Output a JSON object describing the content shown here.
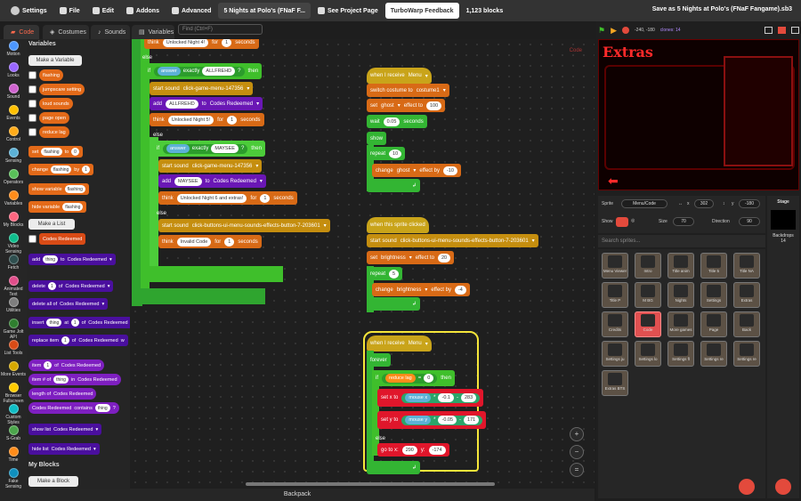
{
  "menubar": {
    "settings": "Settings",
    "file": "File",
    "edit": "Edit",
    "addons": "Addons",
    "advanced": "Advanced",
    "project_title": "5 Nights at Polo's (FNaF F...",
    "see_project": "See Project Page",
    "turbowarp": "TurboWarp Feedback",
    "block_count": "1,123 blocks",
    "save_as": "Save as 5 Nights at Polo's (FNaF Fangame).sb3"
  },
  "tabs": {
    "code": "Code",
    "costumes": "Costumes",
    "sounds": "Sounds",
    "variables": "Variables"
  },
  "find_placeholder": "Find (Ctrl+F)",
  "categories": [
    {
      "label": "Motion",
      "color": "#4c97ff"
    },
    {
      "label": "Looks",
      "color": "#9966ff"
    },
    {
      "label": "Sound",
      "color": "#cf63cf"
    },
    {
      "label": "Events",
      "color": "#ffbf00"
    },
    {
      "label": "Control",
      "color": "#ffab19"
    },
    {
      "label": "Sensing",
      "color": "#5cb1d6"
    },
    {
      "label": "Operators",
      "color": "#59c059"
    },
    {
      "label": "Variables",
      "color": "#ff8c1a"
    },
    {
      "label": "My Blocks",
      "color": "#ff6680"
    },
    {
      "label": "Video Sensing",
      "color": "#0fbd8c"
    },
    {
      "label": "Fetch",
      "color": "#2f4f4f"
    },
    {
      "label": "Animated Text",
      "color": "#e04e8a"
    },
    {
      "label": "Utilities",
      "color": "#7f7f7f"
    },
    {
      "label": "Game Jolt API",
      "color": "#2f7f2f"
    },
    {
      "label": "List Tools",
      "color": "#d94b16"
    },
    {
      "label": "More Events",
      "color": "#d6a800"
    },
    {
      "label": "Browser Fullscreen",
      "color": "#ffcc00"
    },
    {
      "label": "Custom Styles",
      "color": "#0fbdc5"
    },
    {
      "label": "S-Grab",
      "color": "#4ca64c"
    },
    {
      "label": "Time",
      "color": "#ff8c1a"
    },
    {
      "label": "Fake Sensing",
      "color": "#0f8fbd"
    }
  ],
  "palette": {
    "variables_header": "Variables",
    "make_variable": "Make a Variable",
    "vars": [
      "flashing",
      "jumpscare setting",
      "loud sounds",
      "page open",
      "reduce lag"
    ],
    "set_block": {
      "set": "set",
      "var": "flashing",
      "to": "to",
      "val": "0"
    },
    "change_block": {
      "change": "change",
      "var": "flashing",
      "by": "by",
      "val": "1"
    },
    "show_var": {
      "txt": "show variable",
      "var": "flashing"
    },
    "hide_var": {
      "txt": "hide variable",
      "var": "flashing"
    },
    "make_list": "Make a List",
    "list_name": "Codes Redeemed",
    "add_block": {
      "add": "add",
      "thing": "thing",
      "to": "to",
      "list": "Codes Redeemed"
    },
    "delete_block": {
      "del": "delete",
      "n": "1",
      "of": "of",
      "list": "Codes Redeemed"
    },
    "delete_all": {
      "txt": "delete all of",
      "list": "Codes Redeemed"
    },
    "insert_block": {
      "txt": "insert",
      "thing": "thing",
      "at": "at",
      "n": "1",
      "of": "of",
      "list": "Codes Redeemed"
    },
    "replace_block": {
      "txt": "replace item",
      "n": "1",
      "of": "of",
      "list": "Codes Redeemed",
      "w": "w"
    },
    "item_block": {
      "txt": "item",
      "n": "1",
      "of": "of",
      "list": "Codes Redeemed"
    },
    "itemnum_block": {
      "txt": "item # of",
      "thing": "thing",
      "in": "in",
      "list": "Codes Redeemed"
    },
    "length_block": {
      "txt": "length of",
      "list": "Codes Redeemed"
    },
    "contains_block": {
      "list": "Codes Redeemed",
      "txt": "contains",
      "thing": "thing",
      "q": "?"
    },
    "show_list": {
      "txt": "show list",
      "list": "Codes Redeemed"
    },
    "hide_list": {
      "txt": "hide list",
      "list": "Codes Redeemed"
    },
    "myblocks_header": "My Blocks",
    "make_block": "Make a Block"
  },
  "workspace": {
    "code_label": "Code",
    "s1": {
      "think1": {
        "think": "think",
        "msg": "Unlocked Night 4!",
        "for": "for",
        "n": "1",
        "secs": "seconds"
      },
      "else1": "else",
      "if1": {
        "if": "if",
        "answer": "answer",
        "exactly": "exactly",
        "val": "ALLFREHD",
        "q": "?",
        "then": "then"
      },
      "start1": {
        "txt": "start sound",
        "snd": "click-game-menu-147356"
      },
      "add1": {
        "add": "add",
        "val": "ALLFREHD",
        "to": "to",
        "list": "Codes Redeemed"
      },
      "think2": {
        "think": "think",
        "msg": "Unlocked Night 5!",
        "for": "for",
        "n": "1",
        "secs": "seconds"
      },
      "else2": "else",
      "if2": {
        "if": "if",
        "answer": "answer",
        "exactly": "exactly",
        "val": "MAYSEE",
        "q": "?",
        "then": "then"
      },
      "start2": {
        "txt": "start sound",
        "snd": "click-game-menu-147356"
      },
      "add2": {
        "add": "add",
        "val": "MAYSEE",
        "to": "to",
        "list": "Codes Redeemed"
      },
      "think3": {
        "think": "think",
        "msg": "Unlocked Night 6 and extras!",
        "for": "for",
        "n": "1",
        "secs": "seconds"
      },
      "else3": "else",
      "start3": {
        "txt": "start sound",
        "snd": "click-buttons-ui-menu-sounds-effects-button-7-203601"
      },
      "think4": {
        "think": "think",
        "msg": "Invalid Code",
        "for": "for",
        "n": "1",
        "secs": "seconds"
      }
    },
    "s2": {
      "hat": {
        "txt": "when I receive",
        "msg": "Menu"
      },
      "switch": {
        "txt": "switch costume to",
        "c": "costume1"
      },
      "set": {
        "set": "set",
        "eff": "ghost",
        "to": "effect to",
        "v": "100"
      },
      "wait": {
        "txt": "wait",
        "v": "0.05",
        "secs": "seconds"
      },
      "show": "show",
      "repeat": {
        "txt": "repeat",
        "v": "10"
      },
      "change": {
        "txt": "change",
        "eff": "ghost",
        "by": "effect by",
        "v": "-10"
      }
    },
    "s3": {
      "hat": "when this sprite clicked",
      "start": {
        "txt": "start sound",
        "snd": "click-buttons-ui-menu-sounds-effects-button-7-203601"
      },
      "set": {
        "set": "set",
        "eff": "brightness",
        "to": "effect to",
        "v": "20"
      },
      "repeat": {
        "txt": "repeat",
        "v": "5"
      },
      "change": {
        "txt": "change",
        "eff": "brightness",
        "by": "effect by",
        "v": "-4"
      }
    },
    "s4": {
      "hat": {
        "txt": "when I receive",
        "msg": "Menu"
      },
      "forever": "forever",
      "if": {
        "if": "if",
        "var": "reduce lag",
        "eq": "=",
        "v": "0",
        "then": "then"
      },
      "setx": {
        "txt": "set x to",
        "mx": "mouse x",
        "times": "*",
        "a": "-0.1",
        "minus": "-",
        "b": "283"
      },
      "sety": {
        "txt": "set y to",
        "my": "mouse y",
        "times": "*",
        "a": "-0.05",
        "minus": "-",
        "b": "171"
      },
      "else": "else",
      "goto": {
        "txt": "go to x:",
        "x": "290",
        "y_lbl": "y:",
        "y": "-174"
      }
    }
  },
  "backpack": "Backpack",
  "stage": {
    "coords": "-240, -180",
    "clones": "clones: 14",
    "extras_title": "Extras"
  },
  "sprite_info": {
    "sprite_lbl": "Sprite",
    "sprite_name": "Menu/Code",
    "x_lbl": "x",
    "x": "302",
    "y_lbl": "y",
    "y": "-180",
    "show_lbl": "Show",
    "size_lbl": "Size",
    "size": "70",
    "dir_lbl": "Direction",
    "dir": "90"
  },
  "search_placeholder": "Search sprites...",
  "sprites": [
    "Menu Viewer",
    "Intro",
    "Title anim",
    "Title 5",
    "Title NA",
    "Title P",
    "M BG",
    "Nights",
    "Settings",
    "Extras",
    "Credits",
    "Code",
    "More games",
    "Page",
    "Back",
    "Settings ju",
    "Settings lo",
    "Settings fl",
    "Settings re",
    "Settings re",
    "Extras BTS"
  ],
  "stage_panel": {
    "stage": "Stage",
    "backdrops": "Backdrops",
    "count": "14"
  }
}
